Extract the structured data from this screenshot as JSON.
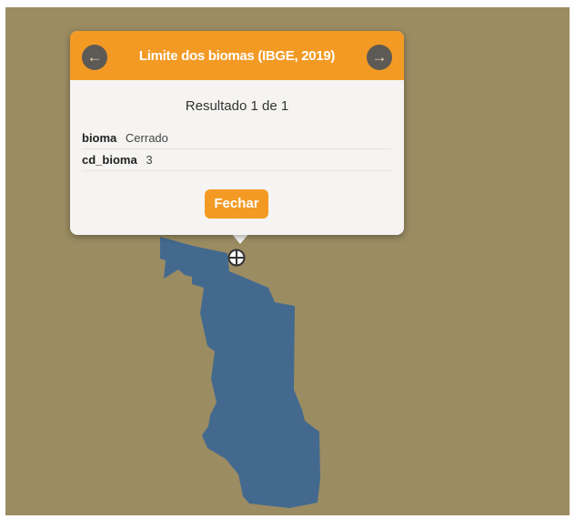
{
  "popup": {
    "title": "Limite dos biomas (IBGE, 2019)",
    "prev_icon": "arrow-left-icon",
    "next_icon": "arrow-right-icon",
    "result_count": "Resultado 1 de 1",
    "attributes": [
      {
        "key": "bioma",
        "value": "Cerrado"
      },
      {
        "key": "cd_bioma",
        "value": "3"
      }
    ],
    "close_label": "Fechar"
  },
  "map": {
    "marker_icon": "crosshair-marker-icon"
  },
  "colors": {
    "map_background": "#9b8c62",
    "polygon_fill": "#43698f",
    "accent": "#f39a24",
    "popup_background": "#f5f4f2",
    "nav_button": "#5d5a55"
  }
}
